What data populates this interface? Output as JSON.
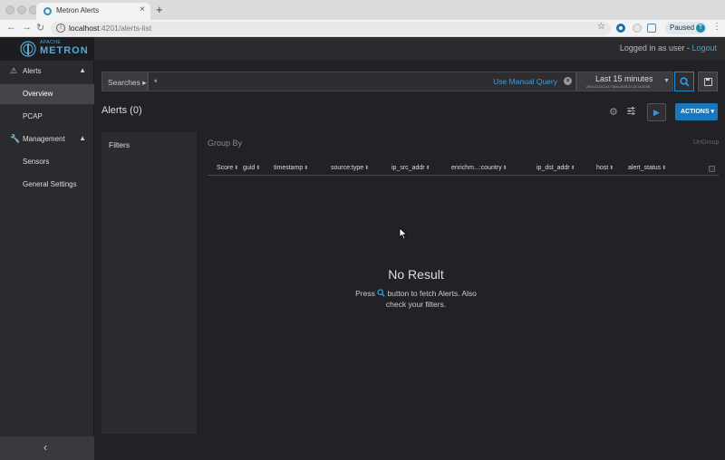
{
  "browser": {
    "tab_title": "Metron Alerts",
    "tab_close": "×",
    "new_tab": "+",
    "back": "←",
    "forward": "→",
    "reload": "↻",
    "url_host": "localhost",
    "url_path": ":4201/alerts-list",
    "info": "i",
    "star": "☆",
    "profile_status": "Paused",
    "profile_initial": "T",
    "menu": "⋮"
  },
  "app": {
    "logo_small": "APACHE",
    "logo_big": "METRON",
    "login_text": "Logged in as user - ",
    "logout_label": "Logout",
    "accent_color": "#1778bf"
  },
  "sidebar": {
    "alerts_label": "Alerts",
    "alerts_caret": "▲",
    "overview_label": "Overview",
    "pcap_label": "PCAP",
    "management_label": "Management",
    "management_caret": "▲",
    "sensors_label": "Sensors",
    "general_settings_label": "General Settings",
    "collapse_glyph": "‹"
  },
  "search": {
    "searches_label": "Searches",
    "searches_caret": "▸",
    "query_value": "*",
    "manual_query_label": "Use Manual Query",
    "clear_glyph": "×",
    "time_label": "Last 15 minutes",
    "time_range": "2019-12-13 14:17:08 to 2019-12-13 14:32:08",
    "time_caret": "▼"
  },
  "alerts": {
    "title": "Alerts (0)",
    "actions_label": "ACTIONS ▾",
    "play_glyph": "▶"
  },
  "filters": {
    "title": "Filters"
  },
  "table": {
    "group_by_label": "Group By",
    "ungroup_label": "UnGroup",
    "sort_glyph": "⬍",
    "columns": [
      "Score",
      "guid",
      "timestamp",
      "source:type",
      "ip_src_addr",
      "enrichm...:country",
      "ip_dst_addr",
      "host",
      "alert_status"
    ]
  },
  "empty_state": {
    "title": "No Result",
    "msg_before": "Press ",
    "msg_after": " button to fetch Alerts. Also check your filters."
  }
}
